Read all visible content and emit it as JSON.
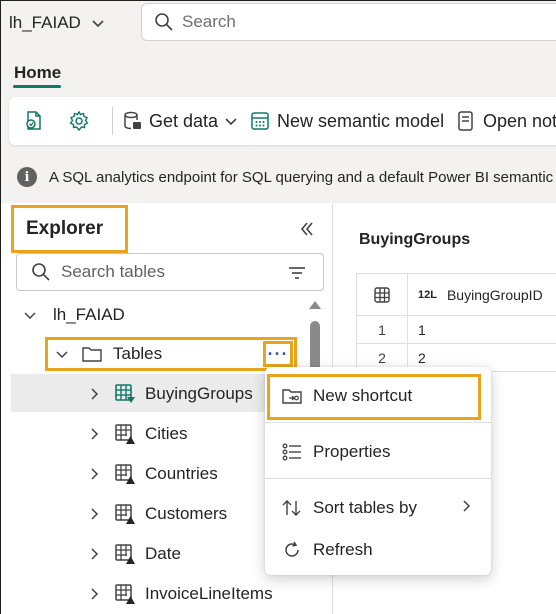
{
  "header": {
    "workspace_name": "lh_FAIAD",
    "search_placeholder": "Search"
  },
  "ribbon": {
    "tab_home": "Home",
    "get_data": "Get data",
    "new_semantic_model": "New semantic model",
    "open_notebook": "Open not"
  },
  "info": {
    "message": "A SQL analytics endpoint for SQL querying and a default Power BI semantic"
  },
  "explorer": {
    "title": "Explorer",
    "search_placeholder": "Search tables",
    "lakehouse": "lh_FAIAD",
    "tables_folder": "Tables",
    "more_glyph": "···",
    "tables": [
      "BuyingGroups",
      "Cities",
      "Countries",
      "Customers",
      "Date",
      "InvoiceLineItems"
    ]
  },
  "preview": {
    "title": "BuyingGroups",
    "column_type": "12L",
    "column_name": "BuyingGroupID",
    "rows": [
      {
        "index": "1",
        "value": "1"
      },
      {
        "index": "2",
        "value": "2"
      }
    ]
  },
  "context_menu": {
    "new_shortcut": "New shortcut",
    "properties": "Properties",
    "sort_tables_by": "Sort tables by",
    "refresh": "Refresh"
  },
  "colors": {
    "highlight_border": "#e8a51c",
    "accent_underline": "#117865",
    "delta_icon": "#117865"
  }
}
